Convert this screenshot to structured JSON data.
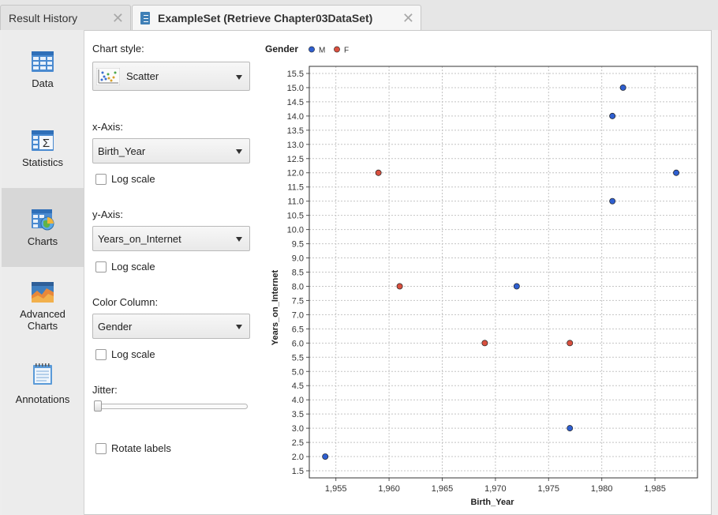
{
  "tabs": [
    {
      "label": "Result History"
    },
    {
      "label": "ExampleSet (Retrieve Chapter03DataSet)"
    }
  ],
  "nav": [
    {
      "label": "Data",
      "icon": "table-icon"
    },
    {
      "label": "Statistics",
      "icon": "sigma-table-icon"
    },
    {
      "label": "Charts",
      "icon": "chart-globe-icon"
    },
    {
      "label_line1": "Advanced",
      "label_line2": "Charts",
      "icon": "advanced-chart-icon"
    },
    {
      "label": "Annotations",
      "icon": "notepad-icon"
    }
  ],
  "config": {
    "chart_style_label": "Chart style:",
    "chart_style_value": "Scatter",
    "x_axis_label": "x-Axis:",
    "x_axis_value": "Birth_Year",
    "y_axis_label": "y-Axis:",
    "y_axis_value": "Years_on_Internet",
    "color_label": "Color Column:",
    "color_value": "Gender",
    "log_scale": "Log scale",
    "jitter_label": "Jitter:",
    "jitter_level": 0,
    "rotate_labels": "Rotate labels"
  },
  "legend": {
    "title": "Gender",
    "items": [
      {
        "name": "M",
        "color": "#2f5fd0"
      },
      {
        "name": "F",
        "color": "#d9503f"
      }
    ]
  },
  "chart_data": {
    "type": "scatter",
    "xlabel": "Birth_Year",
    "ylabel": "Years_on_Internet",
    "xlim": [
      1952.5,
      1989
    ],
    "ylim": [
      1.25,
      15.75
    ],
    "x_ticks": [
      "1,955",
      "1,960",
      "1,965",
      "1,970",
      "1,975",
      "1,980",
      "1,985"
    ],
    "x_tick_values": [
      1955,
      1960,
      1965,
      1970,
      1975,
      1980,
      1985
    ],
    "y_ticks": [
      "1.5",
      "2.0",
      "2.5",
      "3.0",
      "3.5",
      "4.0",
      "4.5",
      "5.0",
      "5.5",
      "6.0",
      "6.5",
      "7.0",
      "7.5",
      "8.0",
      "8.5",
      "9.0",
      "9.5",
      "10.0",
      "10.5",
      "11.0",
      "11.5",
      "12.0",
      "12.5",
      "13.0",
      "13.5",
      "14.0",
      "14.5",
      "15.0",
      "15.5"
    ],
    "grid": true,
    "legend_position": "top-left",
    "series": [
      {
        "name": "M",
        "color": "#2f5fd0",
        "points": [
          [
            1954,
            2.0
          ],
          [
            1977,
            3.0
          ],
          [
            1972,
            8.0
          ],
          [
            1981,
            11.0
          ],
          [
            1987,
            12.0
          ],
          [
            1981,
            14.0
          ],
          [
            1982,
            15.0
          ]
        ]
      },
      {
        "name": "F",
        "color": "#d9503f",
        "points": [
          [
            1959,
            12.0
          ],
          [
            1961,
            8.0
          ],
          [
            1969,
            6.0
          ],
          [
            1977,
            6.0
          ]
        ]
      }
    ]
  }
}
